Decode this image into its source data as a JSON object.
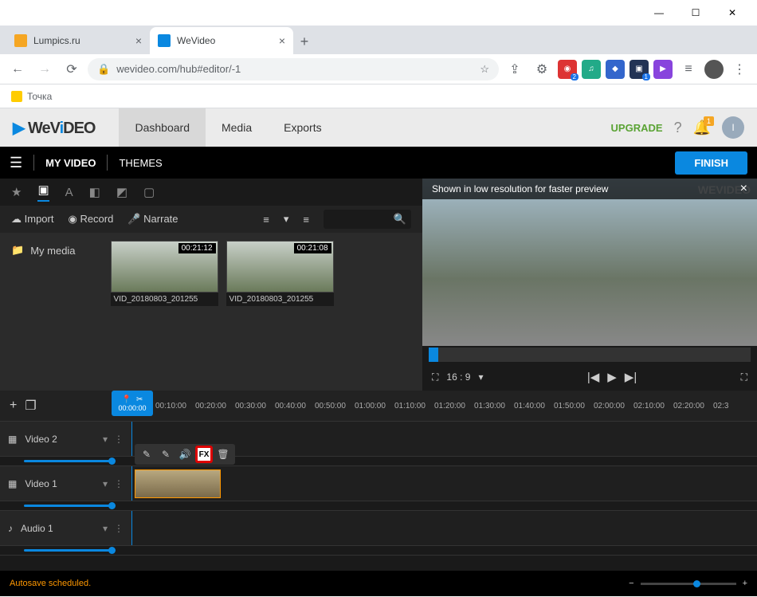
{
  "window": {
    "minimize": "—",
    "maximize": "☐",
    "close": "✕"
  },
  "tabs": [
    {
      "title": "Lumpics.ru",
      "active": false,
      "favicon": "#f5a623"
    },
    {
      "title": "WeVideo",
      "active": true,
      "favicon": "#0a88e0"
    }
  ],
  "browser": {
    "url": "wevideo.com/hub#editor/-1",
    "bookmark": "Точка"
  },
  "wevideo": {
    "nav": [
      "Dashboard",
      "Media",
      "Exports"
    ],
    "upgrade": "UPGRADE",
    "notif": "1"
  },
  "editor": {
    "title": "MY VIDEO",
    "themes": "THEMES",
    "finish": "FINISH"
  },
  "media": {
    "import": "Import",
    "record": "Record",
    "narrate": "Narrate",
    "folder": "My media",
    "clips": [
      {
        "name": "VID_20180803_201255",
        "dur": "00:21:12"
      },
      {
        "name": "VID_20180803_201255",
        "dur": "00:21:08"
      }
    ]
  },
  "preview": {
    "banner": "Shown in low resolution for faster preview",
    "watermark": "WEVIDEO",
    "ratio": "16 : 9"
  },
  "timeline": {
    "playhead": "00:00:00",
    "ticks": [
      "00:10:00",
      "00:20:00",
      "00:30:00",
      "00:40:00",
      "00:50:00",
      "01:00:00",
      "01:10:00",
      "01:20:00",
      "01:30:00",
      "01:40:00",
      "01:50:00",
      "02:00:00",
      "02:10:00",
      "02:20:00",
      "02:3"
    ],
    "tracks": [
      {
        "label": "Video 2",
        "icon": "▦"
      },
      {
        "label": "Video 1",
        "icon": "▦"
      },
      {
        "label": "Audio 1",
        "icon": "♪"
      }
    ],
    "fx": "FX"
  },
  "footer": {
    "status": "Autosave scheduled."
  }
}
